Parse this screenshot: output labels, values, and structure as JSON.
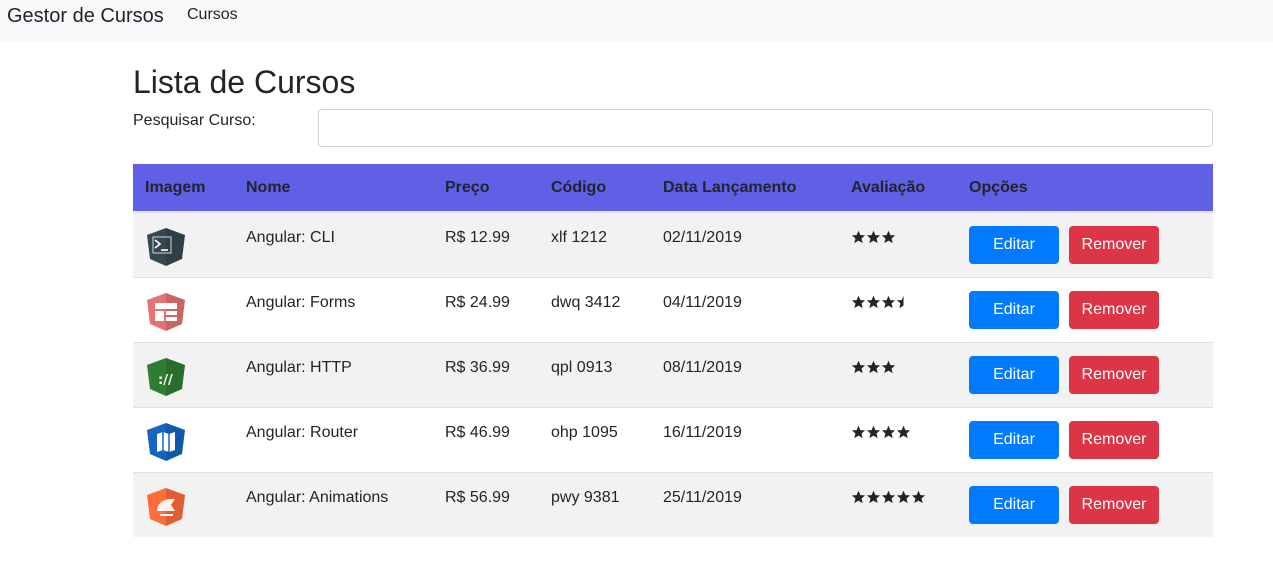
{
  "navbar": {
    "brand": "Gestor de Cursos",
    "link": "Cursos"
  },
  "page": {
    "title": "Lista de Cursos",
    "search_label": "Pesquisar Curso:",
    "search_value": "",
    "search_placeholder": ""
  },
  "table": {
    "headers": [
      "Imagem",
      "Nome",
      "Preço",
      "Código",
      "Data Lançamento",
      "Avaliação",
      "Opções"
    ],
    "edit_label": "Editar",
    "remove_label": "Remover",
    "rows": [
      {
        "nome": "Angular: CLI",
        "preco": "R$ 12.99",
        "codigo": "xlf 1212",
        "data": "02/11/2019",
        "rating": 3,
        "icon": "cli-icon",
        "icon_color": "#37474f"
      },
      {
        "nome": "Angular: Forms",
        "preco": "R$ 24.99",
        "codigo": "dwq 3412",
        "data": "04/11/2019",
        "rating": 3.5,
        "icon": "forms-icon",
        "icon_color": "#e57373"
      },
      {
        "nome": "Angular: HTTP",
        "preco": "R$ 36.99",
        "codigo": "qpl 0913",
        "data": "08/11/2019",
        "rating": 3,
        "icon": "http-icon",
        "icon_color": "#2e7d32"
      },
      {
        "nome": "Angular: Router",
        "preco": "R$ 46.99",
        "codigo": "ohp 1095",
        "data": "16/11/2019",
        "rating": 4,
        "icon": "router-icon",
        "icon_color": "#1565c0"
      },
      {
        "nome": "Angular: Animations",
        "preco": "R$ 56.99",
        "codigo": "pwy 9381",
        "data": "25/11/2019",
        "rating": 5,
        "icon": "animations-icon",
        "icon_color": "#ff6d3a"
      }
    ]
  },
  "colors": {
    "header_bg": "#6060e6",
    "edit_button": "#007bff",
    "remove_button": "#dc3545",
    "navbar_bg": "#f8f9fa"
  }
}
